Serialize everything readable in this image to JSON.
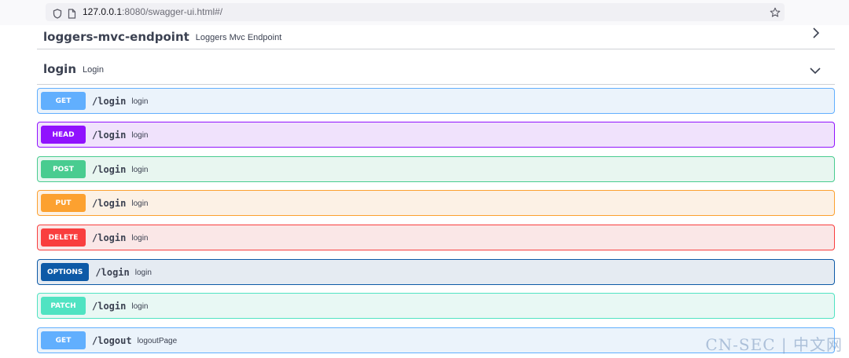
{
  "browser": {
    "url_host": "127.0.0.1",
    "url_rest": ":8080/swagger-ui.html#/"
  },
  "tags": [
    {
      "name": "loggers-mvc-endpoint",
      "description": "Loggers Mvc Endpoint",
      "expanded": false
    },
    {
      "name": "login",
      "description": "Login",
      "expanded": true
    }
  ],
  "operations": [
    {
      "method": "GET",
      "path": "/login",
      "summary": "login",
      "color": "#61affe",
      "bg": "#ebf3fb"
    },
    {
      "method": "HEAD",
      "path": "/login",
      "summary": "login",
      "color": "#9012fe",
      "bg": "#f0e2fc"
    },
    {
      "method": "POST",
      "path": "/login",
      "summary": "login",
      "color": "#49cc90",
      "bg": "#e8f6f0"
    },
    {
      "method": "PUT",
      "path": "/login",
      "summary": "login",
      "color": "#fca130",
      "bg": "#fcf1e5"
    },
    {
      "method": "DELETE",
      "path": "/login",
      "summary": "login",
      "color": "#f93e3e",
      "bg": "#fae7e7"
    },
    {
      "method": "OPTIONS",
      "path": "/login",
      "summary": "login",
      "color": "#0d5aa7",
      "bg": "#e5ebf2"
    },
    {
      "method": "PATCH",
      "path": "/login",
      "summary": "login",
      "color": "#50e3c2",
      "bg": "#e8f8f4"
    },
    {
      "method": "GET",
      "path": "/logout",
      "summary": "logoutPage",
      "color": "#61affe",
      "bg": "#ebf3fb"
    }
  ],
  "watermark": "CN-SEC | 中文网"
}
